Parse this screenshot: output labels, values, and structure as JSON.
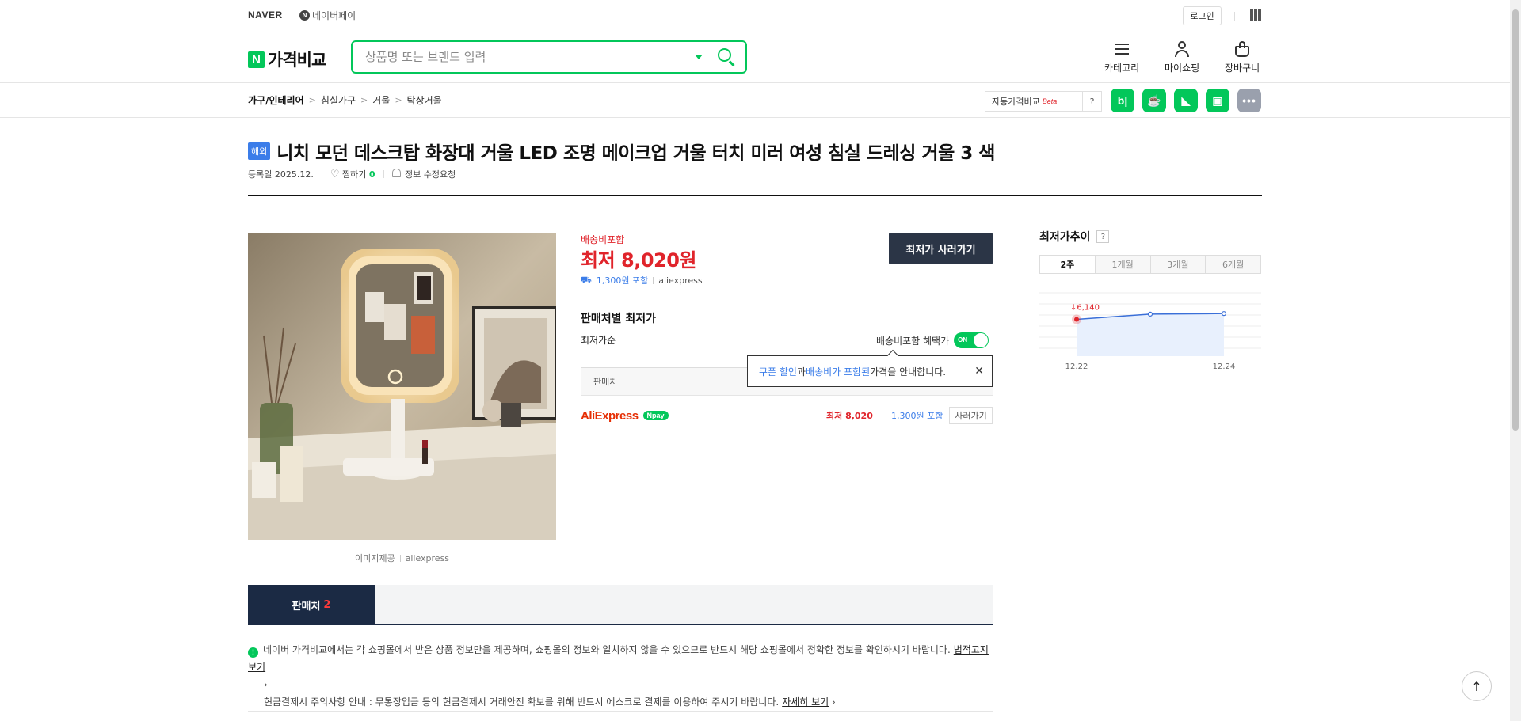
{
  "gnb": {
    "naver": "NAVER",
    "npay_icon": "N",
    "npay": "네이버페이",
    "login": "로그인",
    "apps_icon": "grid-icon"
  },
  "header": {
    "logo_n": "N",
    "logo_text": "가격비교",
    "search_placeholder": "상품명 또는 브랜드 입력",
    "nav": [
      {
        "label": "카테고리",
        "icon": "hamburger-icon"
      },
      {
        "label": "마이쇼핑",
        "icon": "person-icon"
      },
      {
        "label": "장바구니",
        "icon": "bag-icon"
      }
    ]
  },
  "breadcrumb": [
    "가구/인테리어",
    "침실가구",
    "거울",
    "탁상거울"
  ],
  "breadcrumb_sep": ">",
  "auto_compare": {
    "label": "자동가격비교",
    "beta": "Beta",
    "help": "?"
  },
  "share": [
    {
      "icon": "blog-icon",
      "glyph": "b|"
    },
    {
      "icon": "cafe-icon",
      "glyph": "☕"
    },
    {
      "icon": "keep-icon",
      "glyph": "◣"
    },
    {
      "icon": "memo-icon",
      "glyph": "▣"
    },
    {
      "icon": "more-icon",
      "glyph": "•••"
    }
  ],
  "product": {
    "badge": "해외",
    "title": "니치 모던 데스크탑 화장대 거울 LED 조명 메이크업 거울 터치 미러 여성 침실 드레싱 거울 3 색",
    "registered": "등록일 2025.12.",
    "wish_label": "찜하기",
    "wish_count": "0",
    "report": "정보 수정요청",
    "image_credit_label": "이미지제공",
    "image_credit_source": "aliexpress"
  },
  "price": {
    "shipping_included": "배송비포함",
    "lowest": "최저 8,020원",
    "shipping_fee": "1,300원 포함",
    "mall": "aliexpress",
    "buy_lowest": "최저가 사러가기"
  },
  "sellers": {
    "title": "판매처별 최저가",
    "sort": "최저가순",
    "benefit_label": "배송비포함 혜택가",
    "toggle": "ON",
    "column_seller": "판매처",
    "tooltip_hl1": "쿠폰 할인",
    "tooltip_mid": "과 ",
    "tooltip_hl2": "배송비가 포함된",
    "tooltip_rest": " 가격을 안내합니다.",
    "close": "✕",
    "rows": [
      {
        "mall": "AliExpress",
        "npay": "Npay",
        "price": "최저 8,020",
        "fee": "1,300원 포함",
        "buy": "사러가기"
      }
    ]
  },
  "tabs": {
    "sellers_label": "판매처",
    "sellers_count": "2"
  },
  "notice": {
    "line1": "네이버 가격비교에서는 각 쇼핑몰에서 받은 상품 정보만을 제공하며, 쇼핑몰의 정보와 일치하지 않을 수 있으므로 반드시 해당 쇼핑몰에서 정확한 정보를 확인하시기 바랍니다.",
    "line1_link": "법적고지 보기",
    "line2": "현금결제시 주의사항 안내 : 무통장입금 등의 현금결제시 거래안전 확보를 위해 반드시 에스크로 결제를 이용하여 주시기 바랍니다.",
    "line2_link": "자세히 보기"
  },
  "trend": {
    "title": "최저가추이",
    "help": "?",
    "periods": [
      "2주",
      "1개월",
      "3개월",
      "6개월"
    ],
    "active_period": "2주"
  },
  "chart_data": {
    "type": "line",
    "x": [
      "12.22",
      "12.23",
      "12.24"
    ],
    "series": [
      {
        "values": [
          6140,
          6230,
          6240
        ]
      }
    ],
    "xtick_labels": [
      "12.22",
      "12.24"
    ],
    "annotation": "↓6,140",
    "line_color": "#3a6fd8",
    "marker_color": "#e0242b"
  },
  "to_top": "↑"
}
